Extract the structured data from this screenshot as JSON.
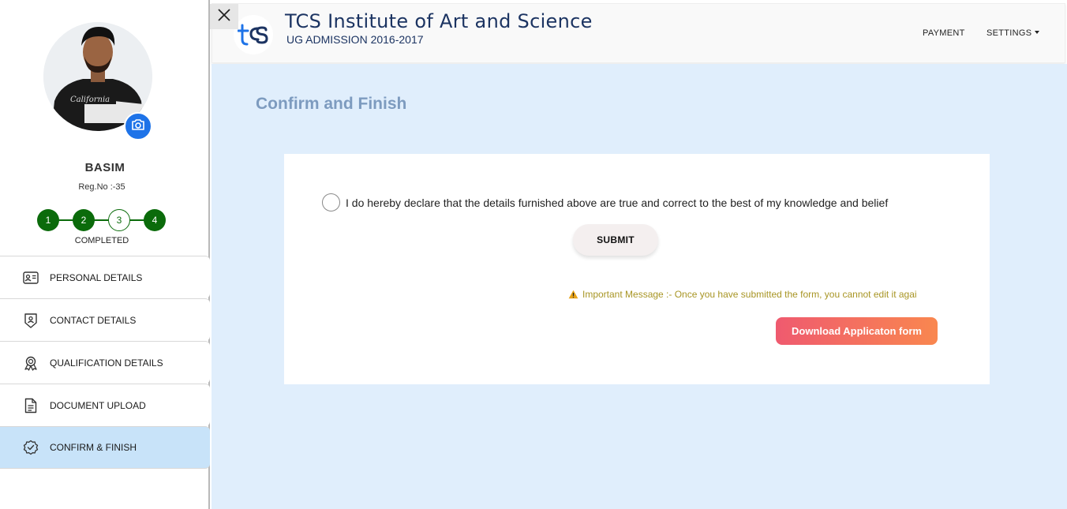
{
  "close": {
    "icon": "close-icon"
  },
  "header": {
    "institute_name": "TCS Institute of Art and Science",
    "subtitle": "UG ADMISSION 2016-2017",
    "links": {
      "payment": "PAYMENT",
      "settings": "SETTINGS"
    }
  },
  "profile": {
    "name": "BASIM",
    "reg_no": "Reg.No :-35",
    "status": "COMPLETED",
    "steps": [
      {
        "label": "1",
        "state": "done"
      },
      {
        "label": "2",
        "state": "done"
      },
      {
        "label": "3",
        "state": "current"
      },
      {
        "label": "4",
        "state": "done"
      }
    ]
  },
  "sidebar": {
    "items": [
      {
        "label": "PERSONAL DETAILS",
        "icon": "id-card-icon"
      },
      {
        "label": "CONTACT DETAILS",
        "icon": "contact-badge-icon"
      },
      {
        "label": "QUALIFICATION DETAILS",
        "icon": "award-icon"
      },
      {
        "label": "DOCUMENT UPLOAD",
        "icon": "document-icon"
      },
      {
        "label": "CONFIRM & FINISH",
        "icon": "check-badge-icon",
        "active": true
      }
    ]
  },
  "main": {
    "title": "Confirm and Finish",
    "declaration": "I do hereby declare that the details furnished above are true and correct to the best of my knowledge and belief",
    "submit_label": "SUBMIT",
    "warning": "Important Message :- Once you have submitted the form, you cannot edit it agai",
    "download_label": "Download Applicaton form"
  },
  "colors": {
    "step_green": "#0b6b0b",
    "active_nav": "#c8e3f9",
    "main_bg": "#e0eefc",
    "title": "#7d9bbf",
    "brand_navy": "#1c3462",
    "warning": "#a89524",
    "download_start": "#ef5a6f",
    "download_end": "#f9874f",
    "camera_blue": "#1e73e8"
  }
}
